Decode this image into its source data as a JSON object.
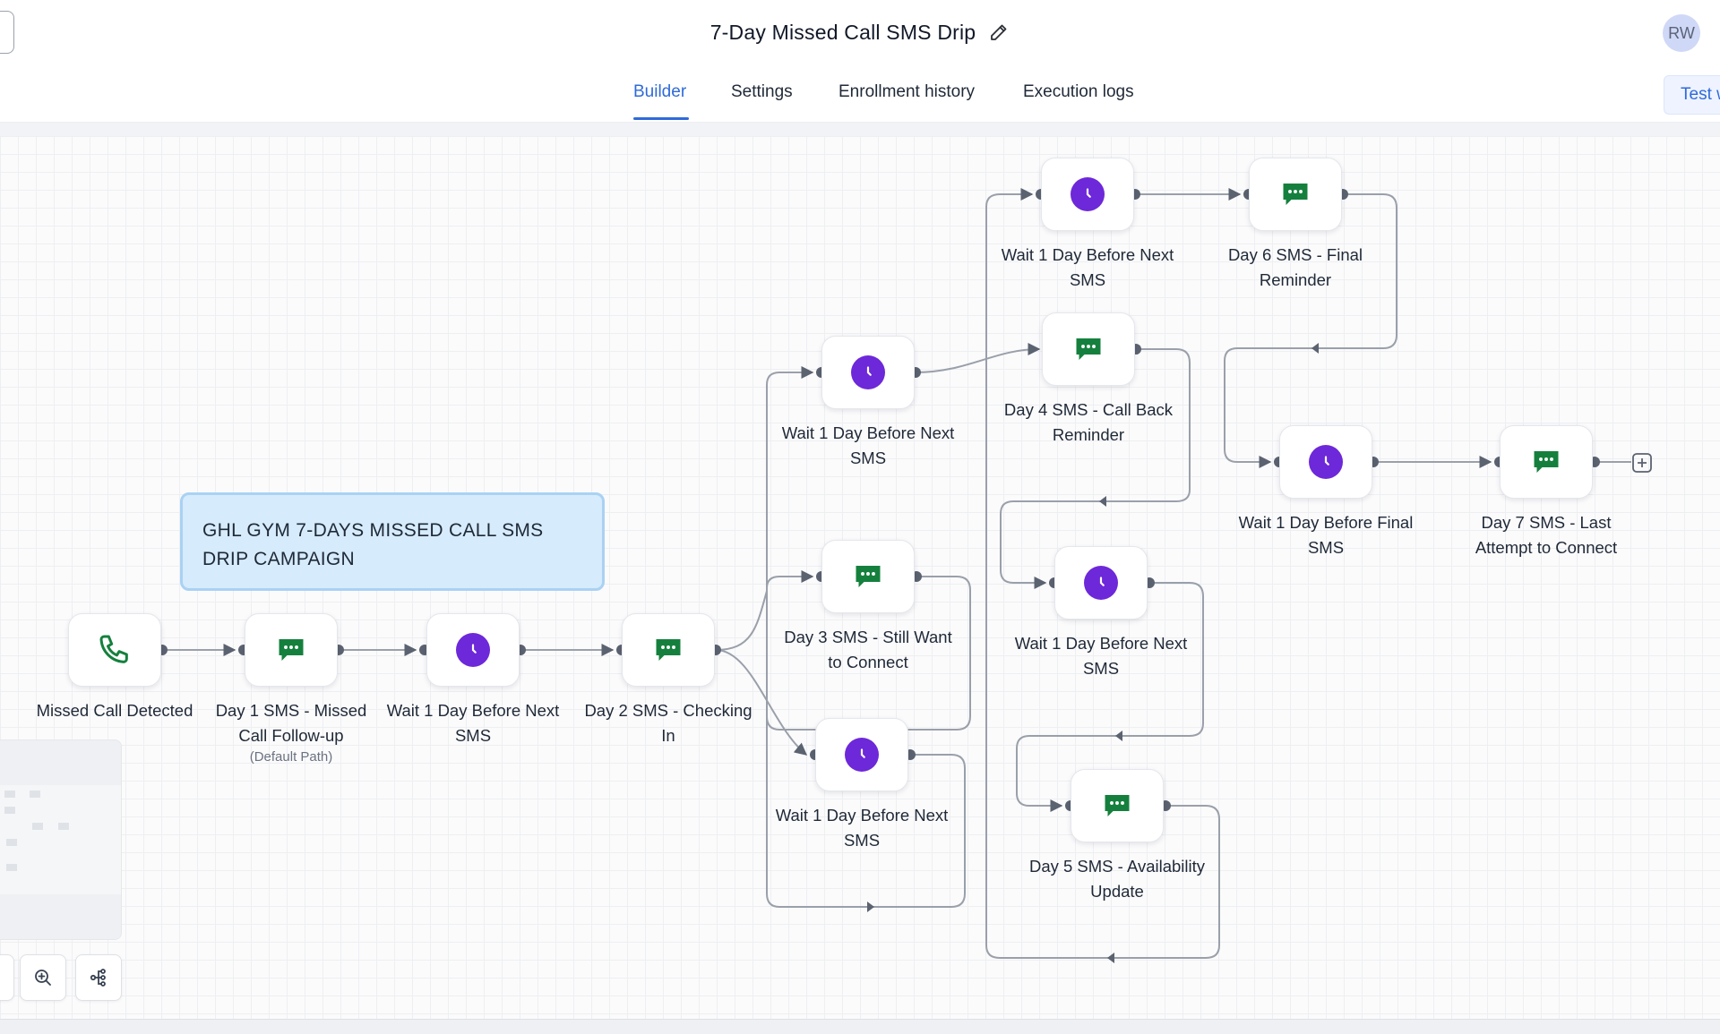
{
  "header": {
    "title": "7-Day Missed Call SMS Drip",
    "avatar_initials": "RW"
  },
  "tabs": [
    {
      "label": "Builder",
      "active": true
    },
    {
      "label": "Settings",
      "active": false
    },
    {
      "label": "Enrollment history",
      "active": false
    },
    {
      "label": "Execution logs",
      "active": false
    }
  ],
  "test_button": {
    "label": "Test w"
  },
  "note": {
    "line1": "GHL GYM 7-DAYS MISSED CALL SMS",
    "line2": "DRIP CAMPAIGN"
  },
  "nodes": {
    "trigger": {
      "label": "Missed Call Detected",
      "icon": "phone-icon"
    },
    "day1": {
      "line1": "Day 1 SMS - Missed",
      "line2": "Call Follow-up",
      "sublabel": "(Default Path)",
      "icon": "sms-icon"
    },
    "wait1": {
      "line1": "Wait 1 Day Before Next",
      "line2": "SMS",
      "icon": "clock-icon"
    },
    "day2": {
      "line1": "Day 2 SMS - Checking",
      "line2": "In",
      "icon": "sms-icon"
    },
    "wait_a": {
      "line1": "Wait 1 Day Before Next",
      "line2": "SMS",
      "icon": "clock-icon"
    },
    "day3": {
      "line1": "Day 3 SMS - Still Want",
      "line2": "to Connect",
      "icon": "sms-icon"
    },
    "wait2": {
      "line1": "Wait 1 Day Before Next",
      "line2": "SMS",
      "icon": "clock-icon"
    },
    "wait_b": {
      "line1": "Wait 1 Day Before Next",
      "line2": "SMS",
      "icon": "clock-icon"
    },
    "day4": {
      "line1": "Day 4 SMS - Call Back",
      "line2": "Reminder",
      "icon": "sms-icon"
    },
    "wait3": {
      "line1": "Wait 1 Day Before Next",
      "line2": "SMS",
      "icon": "clock-icon"
    },
    "day5": {
      "line1": "Day 5 SMS - Availability",
      "line2": "Update",
      "icon": "sms-icon"
    },
    "day6": {
      "line1": "Day 6 SMS - Final",
      "line2": "Reminder",
      "icon": "sms-icon"
    },
    "wait4": {
      "line1": "Wait 1 Day Before Final",
      "line2": "SMS",
      "icon": "clock-icon"
    },
    "day7": {
      "line1": "Day 7 SMS - Last",
      "line2": "Attempt to Connect",
      "icon": "sms-icon"
    }
  },
  "controls": [
    "zoom-in-icon",
    "auto-layout-icon"
  ],
  "colors": {
    "accent": "#2f6ad9",
    "wait": "#6d28d9",
    "sms": "#15803d",
    "note_bg": "#d6ebfb"
  }
}
